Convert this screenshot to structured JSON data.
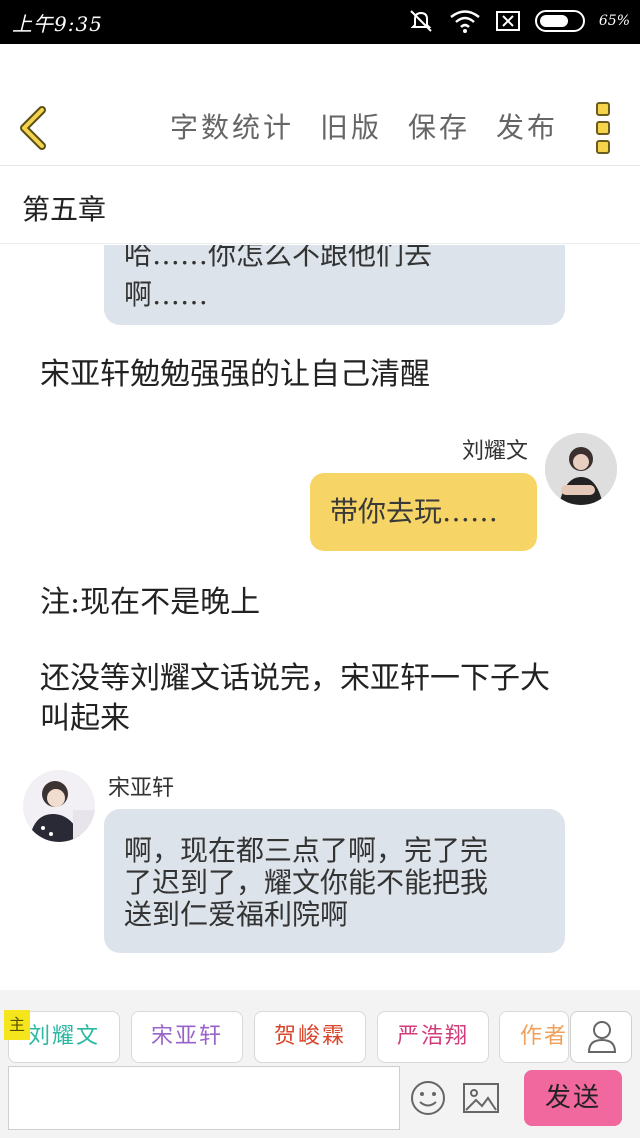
{
  "status_bar": {
    "time": "上午9:35",
    "battery_percent": 65,
    "battery_label": "65%"
  },
  "toolbar": {
    "back_icon": "chevron-left-icon",
    "word_count_label": "字数统计",
    "old_version_label": "旧版",
    "save_label": "保存",
    "publish_label": "发布",
    "menu_icon": "more-vertical-icon"
  },
  "chapter": {
    "title": "第五章"
  },
  "messages": [
    {
      "type": "bubble-left-partial",
      "lines": [
        "哈……你怎么不跟他们去",
        "啊……"
      ]
    },
    {
      "type": "narration",
      "text": "宋亚轩勉勉强强的让自己清醒"
    },
    {
      "type": "bubble-right",
      "speaker": "刘耀文",
      "text": "带你去玩……"
    },
    {
      "type": "narration",
      "text": "注:现在不是晚上"
    },
    {
      "type": "narration",
      "lines": [
        "还没等刘耀文话说完，宋亚轩一下子大",
        "叫起来"
      ]
    },
    {
      "type": "bubble-left",
      "speaker": "宋亚轩",
      "lines": [
        "啊，现在都三点了啊，完了完",
        "了迟到了，耀文你能不能把我",
        "送到仁爱福利院啊"
      ]
    }
  ],
  "characters": {
    "main_badge": "主",
    "items": [
      {
        "name": "刘耀文",
        "color": "#2bb8a3"
      },
      {
        "name": "宋亚轩",
        "color": "#9a63c8"
      },
      {
        "name": "贺峻霖",
        "color": "#d9452b"
      },
      {
        "name": "严浩翔",
        "color": "#d23c7a"
      },
      {
        "name": "作者",
        "color": "#f0a05a"
      }
    ],
    "role_icon": "person-icon"
  },
  "input": {
    "value": "",
    "emoji_icon": "smiley-icon",
    "image_icon": "image-icon",
    "send_label": "发送"
  },
  "colors": {
    "accent_yellow": "#f6d466",
    "bubble_gray": "#dde3ea",
    "send_pink": "#f0689e"
  }
}
